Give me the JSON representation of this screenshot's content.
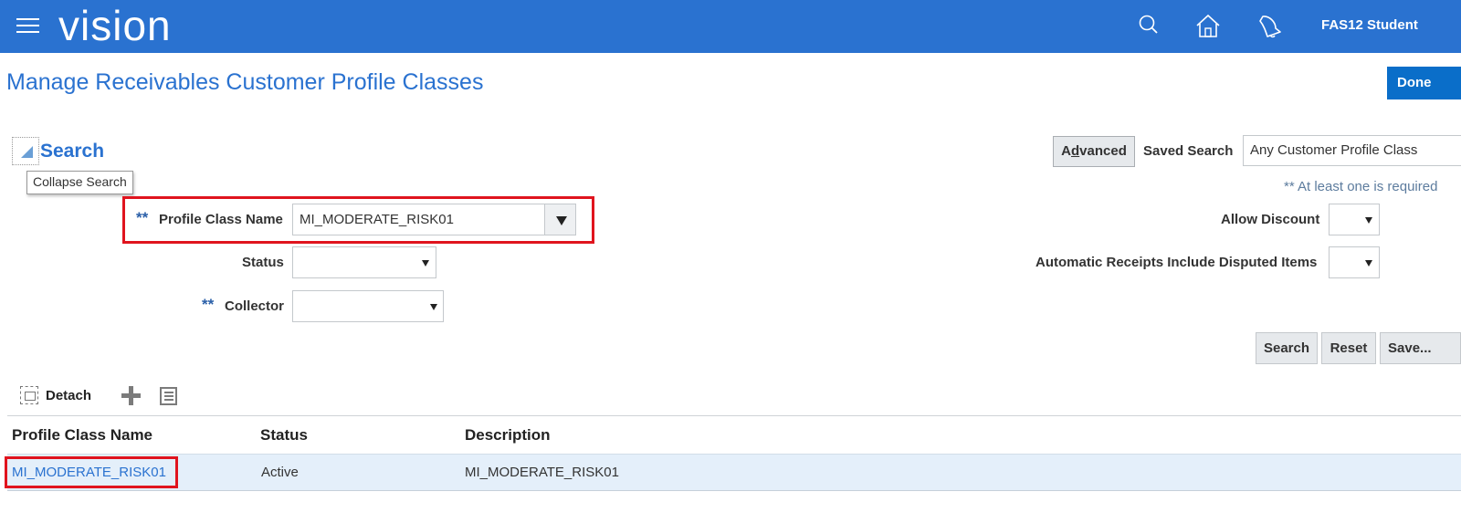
{
  "header": {
    "logo": "vision",
    "user_name": "FAS12 Student",
    "icons": [
      "menu-icon",
      "search-icon",
      "home-icon",
      "notifications-bell-icon"
    ]
  },
  "page": {
    "title": "Manage Receivables Customer Profile Classes",
    "done_label": "Done"
  },
  "search": {
    "heading": "Search",
    "tooltip": "Collapse Search",
    "advanced_label_prefix": "A",
    "advanced_label_underlined": "d",
    "advanced_label_suffix": "vanced",
    "saved_search_label": "Saved Search",
    "saved_search_value": "Any Customer Profile Class",
    "required_note": "** At least one is required",
    "required_marker": "**",
    "fields": {
      "profile_class_name": {
        "label": "Profile Class Name",
        "value": "MI_MODERATE_RISK01"
      },
      "status": {
        "label": "Status",
        "value": ""
      },
      "collector": {
        "label": "Collector",
        "value": ""
      },
      "allow_discount": {
        "label": "Allow Discount",
        "value": ""
      },
      "auto_receipts": {
        "label": "Automatic Receipts Include Disputed Items",
        "value": ""
      }
    },
    "buttons": {
      "search": "Search",
      "reset": "Reset",
      "save": "Save..."
    }
  },
  "toolbar": {
    "detach_label": "Detach"
  },
  "table": {
    "columns": [
      "Profile Class Name",
      "Status",
      "Description"
    ],
    "rows": [
      {
        "name": "MI_MODERATE_RISK01",
        "status": "Active",
        "description": "MI_MODERATE_RISK01"
      }
    ]
  },
  "colors": {
    "header_bg": "#2a72d0",
    "title_blue": "#2a72d0",
    "highlight_red": "#e0141e",
    "row_selected_bg": "#e4effa"
  }
}
